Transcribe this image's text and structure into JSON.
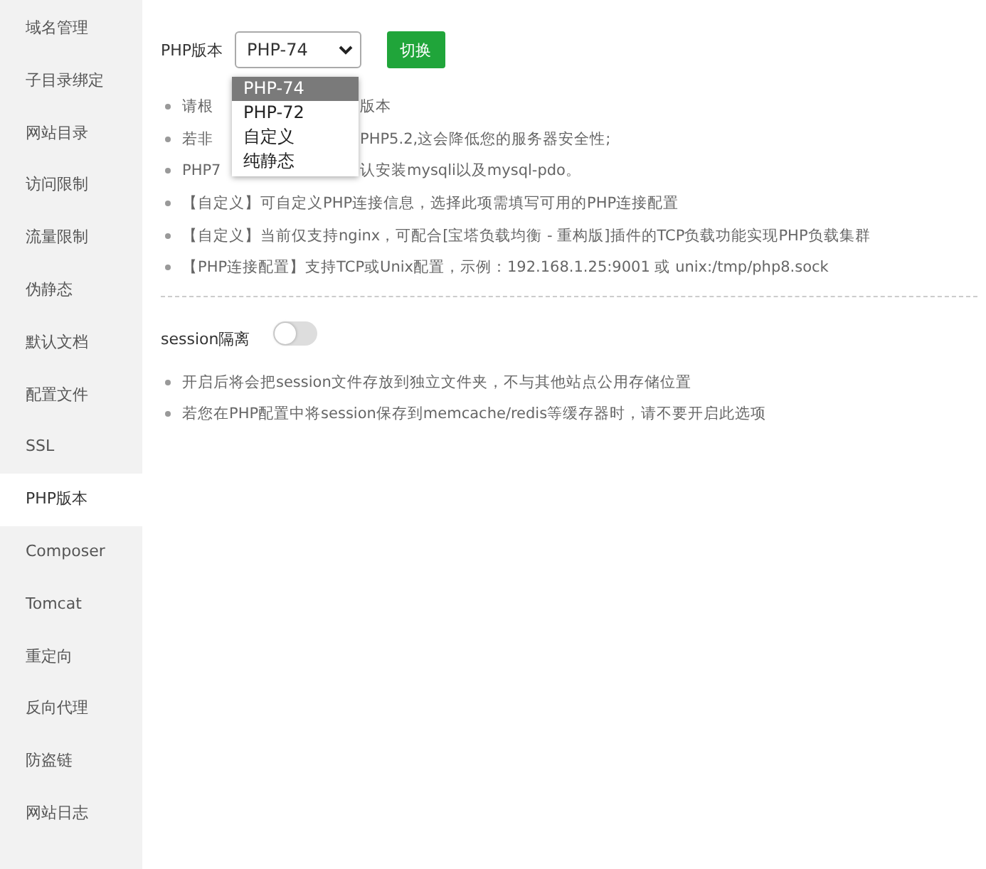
{
  "sidebar": {
    "items": [
      {
        "label": "域名管理",
        "selected": false
      },
      {
        "label": "子目录绑定",
        "selected": false
      },
      {
        "label": "网站目录",
        "selected": false
      },
      {
        "label": "访问限制",
        "selected": false
      },
      {
        "label": "流量限制",
        "selected": false
      },
      {
        "label": "伪静态",
        "selected": false
      },
      {
        "label": "默认文档",
        "selected": false
      },
      {
        "label": "配置文件",
        "selected": false
      },
      {
        "label": "SSL",
        "selected": false
      },
      {
        "label": "PHP版本",
        "selected": true
      },
      {
        "label": "Composer",
        "selected": false
      },
      {
        "label": "Tomcat",
        "selected": false
      },
      {
        "label": "重定向",
        "selected": false
      },
      {
        "label": "反向代理",
        "selected": false
      },
      {
        "label": "防盗链",
        "selected": false
      },
      {
        "label": "网站日志",
        "selected": false
      }
    ]
  },
  "php": {
    "label": "PHP版本",
    "value": "PHP-74",
    "button": "切换",
    "dropdown": {
      "open": true,
      "options": [
        {
          "label": "PHP-74",
          "selected": true
        },
        {
          "label": "PHP-72",
          "selected": false
        },
        {
          "label": "自定义",
          "selected": false
        },
        {
          "label": "纯静态",
          "selected": false
        }
      ]
    },
    "notes": [
      {
        "before": "请根",
        "after": "版本"
      },
      {
        "before": "若非",
        "after": "PHP5.2,这会降低您的服务器安全性;"
      },
      {
        "before": "PHP7",
        "after": "认安装mysqli以及mysql-pdo。"
      },
      {
        "text": "【自定义】可自定义PHP连接信息，选择此项需填写可用的PHP连接配置"
      },
      {
        "text": "【自定义】当前仅支持nginx，可配合[宝塔负载均衡 - 重构版]插件的TCP负载功能实现PHP负载集群"
      },
      {
        "text": "【PHP连接配置】支持TCP或Unix配置，示例：192.168.1.25:9001 或 unix:/tmp/php8.sock"
      }
    ]
  },
  "session": {
    "label": "session隔离",
    "on": false,
    "notes": [
      {
        "text": "开启后将会把session文件存放到独立文件夹，不与其他站点公用存储位置"
      },
      {
        "text": "若您在PHP配置中将session保存到memcache/redis等缓存器时，请不要开启此选项"
      }
    ]
  }
}
